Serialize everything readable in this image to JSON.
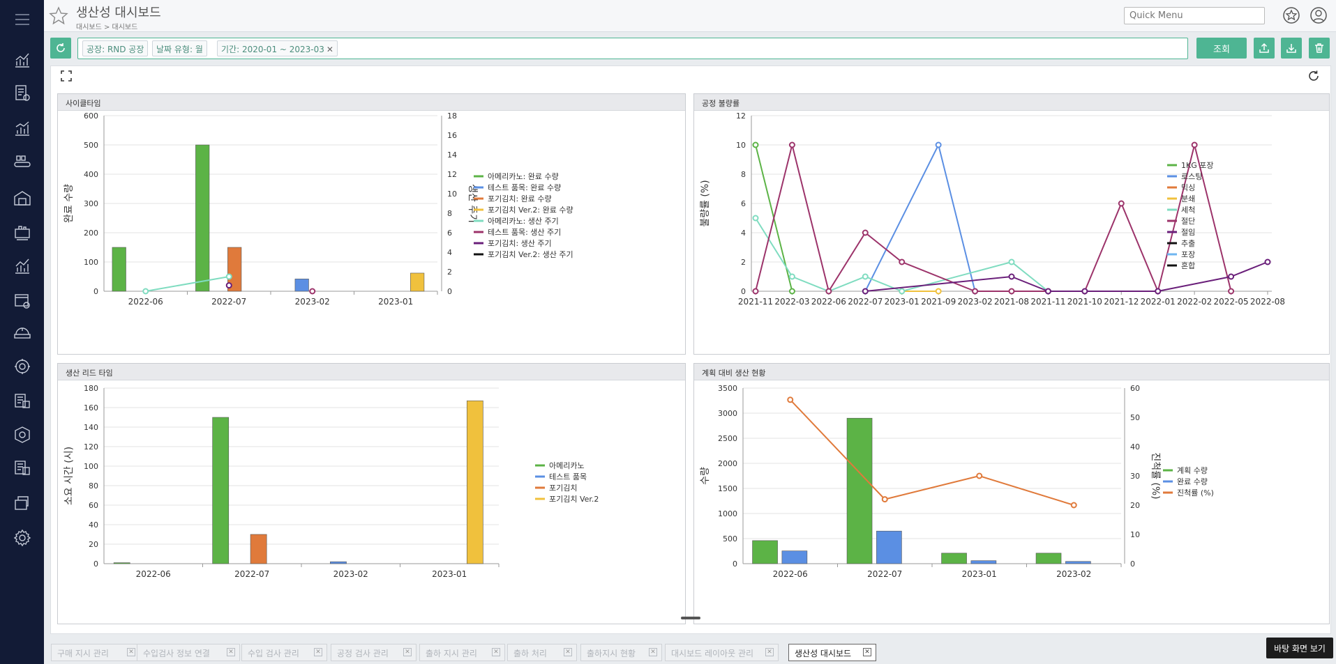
{
  "header": {
    "title": "생산성 대시보드",
    "breadcrumb": "대시보드 > 대시보드",
    "quick_menu_placeholder": "Quick Menu"
  },
  "filters": {
    "chips": [
      "공장: RND 공장",
      "날짜 유형: 월",
      "기간: 2020-01 ~ 2023-03"
    ],
    "search_label": "조회"
  },
  "colors": {
    "accent": "#4eb593",
    "sidebar": "#121b36",
    "green": "#5cb346",
    "blue": "#5b8fe3",
    "orange": "#e07a3b",
    "yellow": "#f0c13d",
    "teal": "#7fdcc0",
    "magenta": "#9c336a",
    "purple": "#6a1f7a",
    "black": "#111111"
  },
  "sidebar": {
    "icons": [
      "menu-icon",
      "line-chart-icon",
      "invoice-icon",
      "bar-chart-icon",
      "conveyor-icon",
      "factory-icon",
      "machine-icon",
      "trend-icon",
      "inspection-icon",
      "quality-icon",
      "settings-gear-icon",
      "document-icon",
      "box-icon",
      "report-icon",
      "folder-icon",
      "system-gear-icon"
    ]
  },
  "panels": {
    "cycle_time": "사이클타임",
    "defect_rate": "공정 불량률",
    "lead_time": "생산 리드 타임",
    "plan_vs_actual": "계획 대비 생산 현황"
  },
  "chart_data": [
    {
      "id": "cycle_time",
      "type": "bar",
      "categories": [
        "2022-06",
        "2022-07",
        "2023-02",
        "2023-01"
      ],
      "ylabel": "완료 수량",
      "y2label": "생산 주기",
      "ylim": [
        0,
        600
      ],
      "yticks": [
        0,
        100,
        200,
        300,
        400,
        500,
        600
      ],
      "y2lim": [
        0,
        18
      ],
      "y2ticks": [
        0,
        2,
        4,
        6,
        8,
        10,
        12,
        14,
        16,
        18
      ],
      "legend_position": "right",
      "series": [
        {
          "name": "아메리카노: 완료 수량",
          "kind": "bar",
          "color": "#5cb346",
          "values": [
            150,
            500,
            null,
            null
          ]
        },
        {
          "name": "테스트 품목: 완료 수량",
          "kind": "bar",
          "color": "#5b8fe3",
          "values": [
            null,
            null,
            42,
            null
          ]
        },
        {
          "name": "포기김치: 완료 수량",
          "kind": "bar",
          "color": "#e07a3b",
          "values": [
            null,
            150,
            null,
            null
          ]
        },
        {
          "name": "포기김치 Ver.2: 완료 수량",
          "kind": "bar",
          "color": "#f0c13d",
          "values": [
            null,
            null,
            null,
            62
          ]
        },
        {
          "name": "아메리카노: 생산 주기",
          "kind": "line",
          "axis": 2,
          "color": "#7fdcc0",
          "values": [
            0,
            1.5,
            null,
            null
          ]
        },
        {
          "name": "테스트 품목: 생산 주기",
          "kind": "line",
          "axis": 2,
          "color": "#9c336a",
          "values": [
            null,
            null,
            0,
            null
          ]
        },
        {
          "name": "포기김치: 생산 주기",
          "kind": "line",
          "axis": 2,
          "color": "#6a1f7a",
          "values": [
            null,
            0.6,
            null,
            null
          ]
        },
        {
          "name": "포기김치 Ver.2: 생산 주기",
          "kind": "line",
          "axis": 2,
          "color": "#111111",
          "values": [
            null,
            null,
            null,
            null
          ]
        }
      ]
    },
    {
      "id": "defect_rate",
      "type": "line",
      "categories": [
        "2021-11",
        "2022-03",
        "2022-06",
        "2022-07",
        "2023-01",
        "2021-09",
        "2023-02",
        "2021-08",
        "2021-11",
        "2021-10",
        "2021-12",
        "2022-01",
        "2022-02",
        "2022-05",
        "2022-08"
      ],
      "ylabel": "불량률 (%)",
      "ylim": [
        0,
        12
      ],
      "yticks": [
        0,
        2,
        4,
        6,
        8,
        10,
        12
      ],
      "legend_position": "right",
      "series": [
        {
          "name": "1KG 포장",
          "color": "#5cb346",
          "values": [
            10,
            0,
            null,
            null,
            null,
            null,
            null,
            null,
            null,
            null,
            null,
            null,
            null,
            null,
            null
          ]
        },
        {
          "name": "로스팅",
          "color": "#5b8fe3",
          "values": [
            null,
            null,
            null,
            0,
            null,
            10,
            0,
            null,
            null,
            null,
            null,
            null,
            null,
            null,
            null
          ]
        },
        {
          "name": "믹싱",
          "color": "#e07a3b",
          "values": []
        },
        {
          "name": "분쇄",
          "color": "#f0c13d",
          "values": [
            null,
            null,
            null,
            null,
            0,
            0,
            null,
            null,
            null,
            null,
            null,
            null,
            null,
            null,
            null
          ]
        },
        {
          "name": "세척",
          "color": "#7fdcc0",
          "values": [
            5,
            1,
            0,
            1,
            0,
            null,
            null,
            2,
            0,
            null,
            null,
            null,
            null,
            null,
            null
          ]
        },
        {
          "name": "절단",
          "color": "#9c336a",
          "values": [
            0,
            10,
            0,
            4,
            2,
            null,
            0,
            0,
            0,
            0,
            6,
            0,
            10,
            0,
            null
          ]
        },
        {
          "name": "절임",
          "color": "#6a1f7a",
          "values": [
            null,
            null,
            null,
            0,
            null,
            null,
            null,
            1,
            0,
            0,
            null,
            0,
            null,
            1,
            2
          ]
        },
        {
          "name": "추출",
          "color": "#111111",
          "values": []
        },
        {
          "name": "포장",
          "color": "#6fb6f0",
          "values": []
        },
        {
          "name": "혼합",
          "color": "#111111",
          "values": []
        }
      ]
    },
    {
      "id": "lead_time",
      "type": "bar",
      "categories": [
        "2022-06",
        "2022-07",
        "2023-02",
        "2023-01"
      ],
      "ylabel": "소요 시간 (시)",
      "ylim": [
        0,
        180
      ],
      "yticks": [
        0,
        20,
        40,
        60,
        80,
        100,
        120,
        140,
        160,
        180
      ],
      "legend_position": "right",
      "series": [
        {
          "name": "아메리카노",
          "color": "#5cb346",
          "values": [
            1,
            150,
            null,
            null
          ]
        },
        {
          "name": "테스트 품목",
          "color": "#5b8fe3",
          "values": [
            null,
            null,
            2,
            null
          ]
        },
        {
          "name": "포기김치",
          "color": "#e07a3b",
          "values": [
            null,
            30,
            null,
            null
          ]
        },
        {
          "name": "포기김치 Ver.2",
          "color": "#f0c13d",
          "values": [
            null,
            null,
            null,
            167
          ]
        }
      ]
    },
    {
      "id": "plan_vs_actual",
      "type": "bar",
      "categories": [
        "2022-06",
        "2022-07",
        "2023-01",
        "2023-02"
      ],
      "ylabel": "수량",
      "y2label": "진척률 (%)",
      "ylim": [
        0,
        3500
      ],
      "yticks": [
        0,
        500,
        1000,
        1500,
        2000,
        2500,
        3000,
        3500
      ],
      "y2lim": [
        0,
        60
      ],
      "y2ticks": [
        0,
        10,
        20,
        30,
        40,
        50,
        60
      ],
      "legend_position": "right",
      "series": [
        {
          "name": "계획 수량",
          "kind": "bar",
          "color": "#5cb346",
          "values": [
            460,
            2900,
            210,
            210
          ]
        },
        {
          "name": "완료 수량",
          "kind": "bar",
          "color": "#5b8fe3",
          "values": [
            255,
            650,
            60,
            45
          ]
        },
        {
          "name": "진척률 (%)",
          "kind": "line",
          "axis": 2,
          "color": "#e07a3b",
          "values": [
            56,
            22,
            30,
            20
          ]
        }
      ]
    }
  ],
  "tabs": [
    {
      "label": "구매 지시 관리",
      "active": false
    },
    {
      "label": "수입검사 정보 연결",
      "active": false
    },
    {
      "label": "수입 검사 관리",
      "active": false
    },
    {
      "label": "공정 검사 관리",
      "active": false
    },
    {
      "label": "출하 지시 관리",
      "active": false
    },
    {
      "label": "출하 처리",
      "active": false
    },
    {
      "label": "출하지시 현황",
      "active": false
    },
    {
      "label": "대시보드 레이아웃 관리",
      "active": false
    },
    {
      "label": "생산성 대시보드",
      "active": true
    }
  ],
  "desktop_button": "바탕 화면 보기"
}
